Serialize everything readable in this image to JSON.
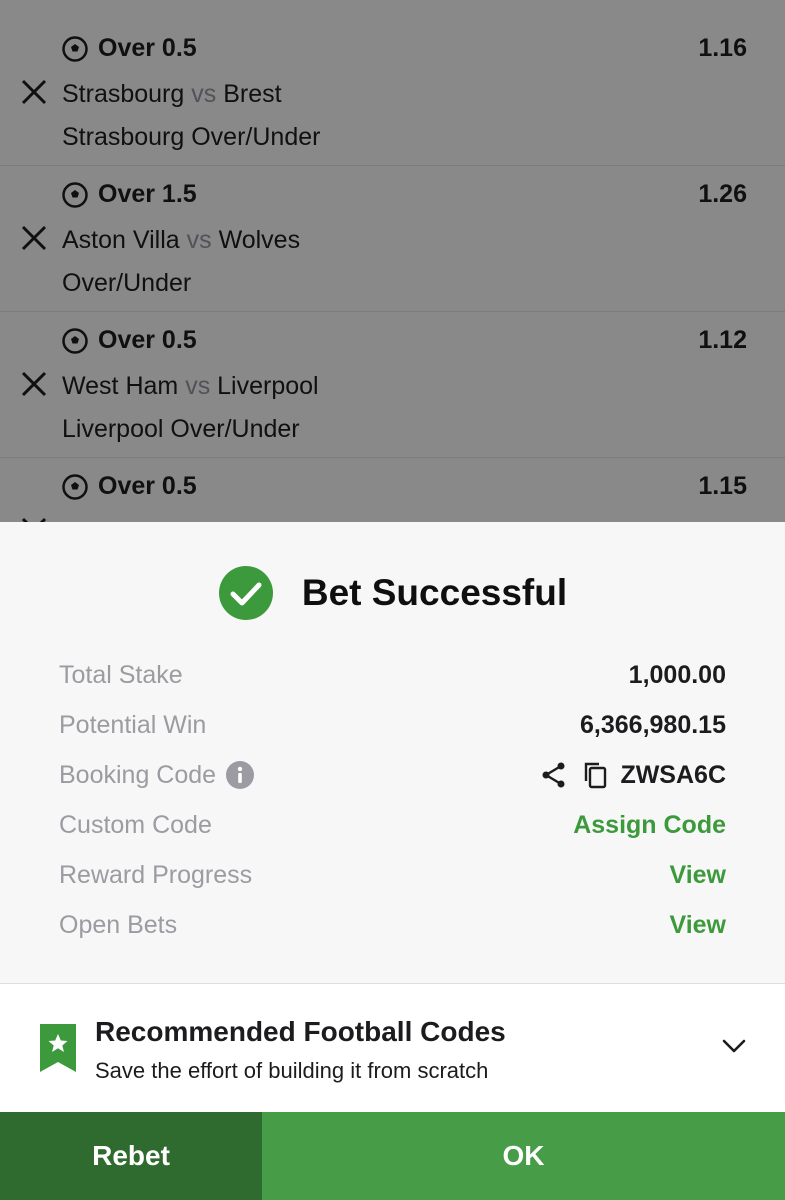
{
  "bets": [
    {
      "selection": "Over 0.5",
      "odds": "1.16",
      "home": "Strasbourg",
      "vs": "vs",
      "away": "Brest",
      "market": "Strasbourg Over/Under"
    },
    {
      "selection": "Over 1.5",
      "odds": "1.26",
      "home": "Aston Villa",
      "vs": "vs",
      "away": "Wolves",
      "market": "Over/Under"
    },
    {
      "selection": "Over 0.5",
      "odds": "1.12",
      "home": "West Ham",
      "vs": "vs",
      "away": "Liverpool",
      "market": "Liverpool Over/Under"
    },
    {
      "selection": "Over 0.5",
      "odds": "1.15",
      "home": "",
      "vs": "",
      "away": "",
      "market": ""
    }
  ],
  "modal": {
    "title": "Bet Successful",
    "rows": {
      "total_stake_label": "Total Stake",
      "total_stake_value": "1,000.00",
      "potential_win_label": "Potential Win",
      "potential_win_value": "6,366,980.15",
      "booking_code_label": "Booking Code",
      "booking_code_value": "ZWSA6C",
      "custom_code_label": "Custom Code",
      "custom_code_value": "Assign Code",
      "reward_progress_label": "Reward Progress",
      "reward_progress_value": "View",
      "open_bets_label": "Open Bets",
      "open_bets_value": "View"
    },
    "recommended": {
      "title": "Recommended Football Codes",
      "subtitle": "Save the effort of building it from scratch"
    },
    "buttons": {
      "rebet": "Rebet",
      "ok": "OK"
    }
  },
  "colors": {
    "accent_green": "#3c9a3d",
    "ok_button": "#479c48",
    "rebet_button": "#2f6b2f"
  },
  "icons": [
    "football-icon",
    "close-icon",
    "check-circle-icon",
    "info-icon",
    "share-icon",
    "copy-icon",
    "star-bookmark-icon",
    "chevron-down-icon"
  ]
}
